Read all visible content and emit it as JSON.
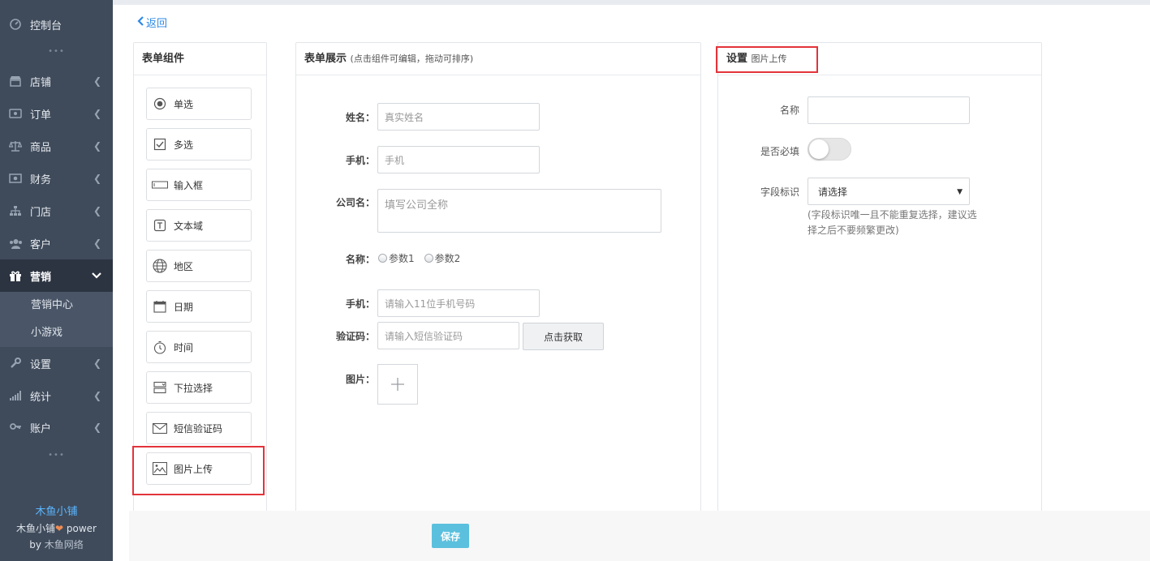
{
  "sidebar": {
    "items": [
      {
        "label": "控制台",
        "icon": "dashboard-icon"
      },
      {
        "label": "店铺",
        "icon": "shop-icon"
      },
      {
        "label": "订单",
        "icon": "order-icon"
      },
      {
        "label": "商品",
        "icon": "scale-icon"
      },
      {
        "label": "财务",
        "icon": "money-icon"
      },
      {
        "label": "门店",
        "icon": "sitemap-icon"
      },
      {
        "label": "客户",
        "icon": "users-icon"
      },
      {
        "label": "营销",
        "icon": "gift-icon"
      },
      {
        "label": "设置",
        "icon": "wrench-icon"
      },
      {
        "label": "统计",
        "icon": "signal-icon"
      },
      {
        "label": "账户",
        "icon": "key-icon"
      }
    ],
    "submenu": [
      "营销中心",
      "小游戏"
    ],
    "dots": "•••",
    "footer": {
      "brand": "木鱼小铺",
      "line1_prefix": "木鱼小铺",
      "heart": "❤",
      "line1_suffix": " power",
      "line2_prefix": "by ",
      "line2_company": "木鱼网络"
    }
  },
  "back": {
    "label": "返回"
  },
  "components_panel": {
    "title": "表单组件",
    "items": [
      {
        "label": "单选",
        "icon": "radio-icon"
      },
      {
        "label": "多选",
        "icon": "checkbox-icon"
      },
      {
        "label": "输入框",
        "icon": "input-icon"
      },
      {
        "label": "文本域",
        "icon": "textarea-icon"
      },
      {
        "label": "地区",
        "icon": "globe-icon"
      },
      {
        "label": "日期",
        "icon": "calendar-icon"
      },
      {
        "label": "时间",
        "icon": "clock-icon"
      },
      {
        "label": "下拉选择",
        "icon": "dropdown-icon"
      },
      {
        "label": "短信验证码",
        "icon": "envelope-icon"
      },
      {
        "label": "图片上传",
        "icon": "image-icon"
      }
    ]
  },
  "preview_panel": {
    "title": "表单展示",
    "subtitle": "(点击组件可编辑，拖动可排序)",
    "fields": {
      "name_label": "姓名：",
      "name_placeholder": "真实姓名",
      "phone_label": "手机：",
      "phone_placeholder": "手机",
      "company_label": "公司名：",
      "company_placeholder": "填写公司全称",
      "param_label": "名称：",
      "param_options": [
        "参数1",
        "参数2"
      ],
      "mobile_label": "手机：",
      "mobile_placeholder": "请输入11位手机号码",
      "code_label": "验证码：",
      "code_placeholder": "请输入短信验证码",
      "code_button": "点击获取",
      "image_label": "图片："
    }
  },
  "settings_panel": {
    "title": "设置",
    "subtitle": "图片上传",
    "name_label": "名称",
    "required_label": "是否必填",
    "required_on": false,
    "field_id_label": "字段标识",
    "field_id_value": "请选择",
    "hint": "(字段标识唯一且不能重复选择，建议选择之后不要频繁更改)"
  },
  "bottom": {
    "save_label": "保存"
  },
  "colors": {
    "sidebar": "#3f4b5b",
    "active": "#2c3441",
    "link": "#2f8ae5",
    "save": "#5bc0de",
    "highlight": "#e3343b"
  }
}
